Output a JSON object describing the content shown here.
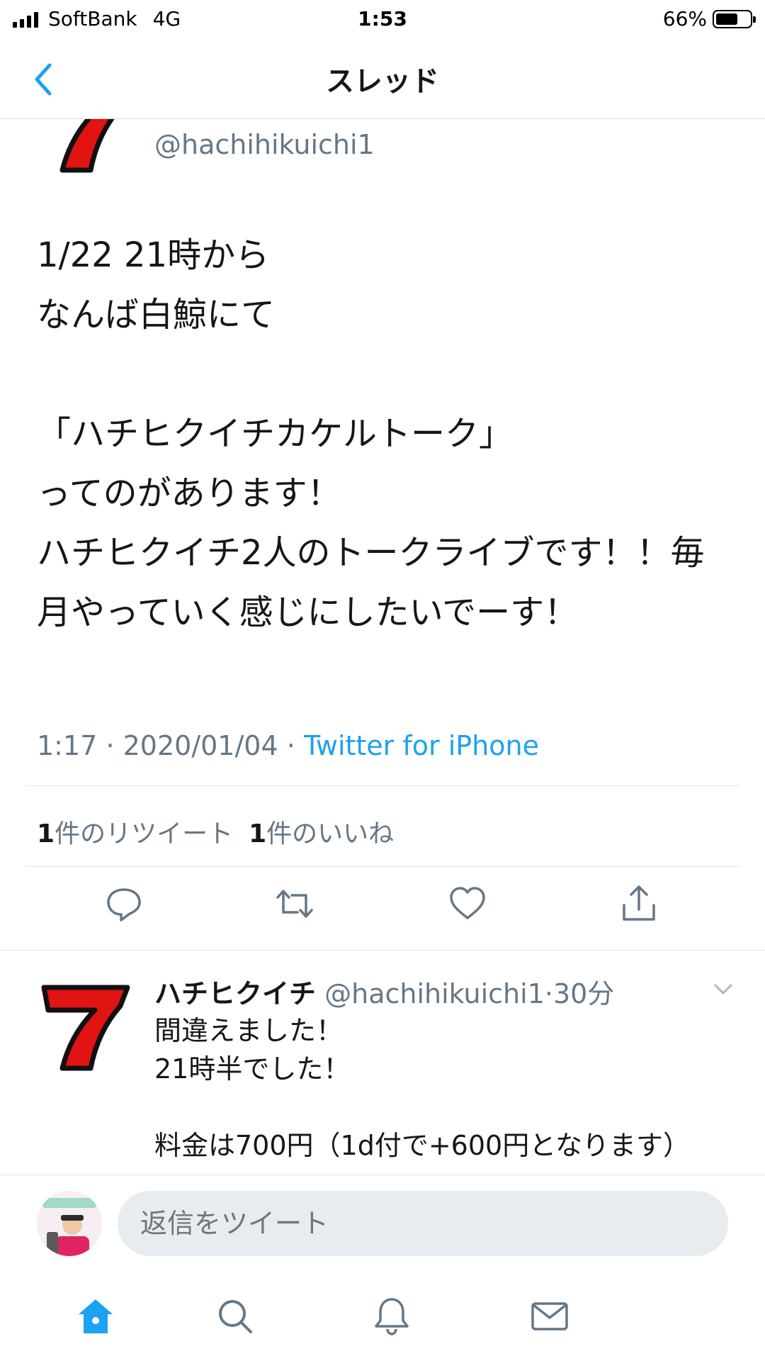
{
  "status_bar": {
    "carrier": "SoftBank",
    "network": "4G",
    "time": "1:53",
    "battery": "66%",
    "battery_level": 0.66
  },
  "nav": {
    "title": "スレッド",
    "back_icon": "chevron-left-icon"
  },
  "main_tweet": {
    "handle": "@hachihikuichi1",
    "text": "1/22 21時から\nなんば白鯨にて\n\n「ハチヒクイチカケルトーク」\nってのがあります！\nハチヒクイチ2人のトークライブです！！毎月やっていく感じにしたいでーす！",
    "time": "1:17",
    "date": "2020/01/04",
    "separator": "·",
    "source": "Twitter for iPhone",
    "retweet_count": "1",
    "retweet_label": "件のリツイート",
    "like_count": "1",
    "like_label": "件のいいね",
    "actions": [
      "reply-icon",
      "retweet-icon",
      "like-icon",
      "share-icon"
    ]
  },
  "reply_tweet": {
    "display_name": "ハチヒクイチ",
    "handle": "@hachihikuichi1",
    "separator": "·",
    "time_ago": "30分",
    "text": "間違えました！\n21時半でした！\n\n料金は700円（1d付で+600円となります）"
  },
  "compose": {
    "placeholder": "返信をツイート"
  },
  "tab_bar": {
    "tabs": [
      "home-icon",
      "search-icon",
      "notifications-icon",
      "messages-icon"
    ],
    "active": "home-icon"
  },
  "colors": {
    "accent": "#1da1f2",
    "text": "#14171a",
    "secondary": "#657786",
    "icon": "#657786",
    "avatar_red": "#e11313"
  }
}
